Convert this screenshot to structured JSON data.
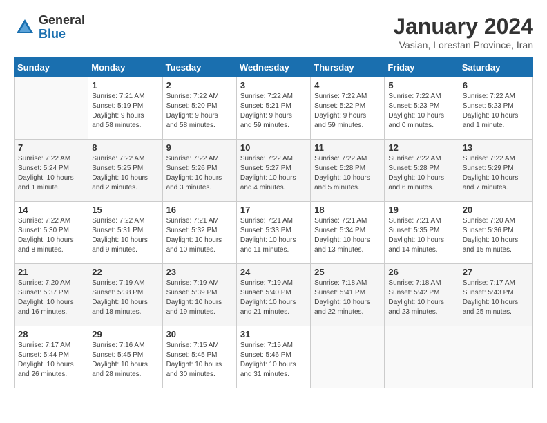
{
  "header": {
    "logo_general": "General",
    "logo_blue": "Blue",
    "title": "January 2024",
    "subtitle": "Vasian, Lorestan Province, Iran"
  },
  "weekdays": [
    "Sunday",
    "Monday",
    "Tuesday",
    "Wednesday",
    "Thursday",
    "Friday",
    "Saturday"
  ],
  "weeks": [
    [
      {
        "day": "",
        "info": ""
      },
      {
        "day": "1",
        "info": "Sunrise: 7:21 AM\nSunset: 5:19 PM\nDaylight: 9 hours\nand 58 minutes."
      },
      {
        "day": "2",
        "info": "Sunrise: 7:22 AM\nSunset: 5:20 PM\nDaylight: 9 hours\nand 58 minutes."
      },
      {
        "day": "3",
        "info": "Sunrise: 7:22 AM\nSunset: 5:21 PM\nDaylight: 9 hours\nand 59 minutes."
      },
      {
        "day": "4",
        "info": "Sunrise: 7:22 AM\nSunset: 5:22 PM\nDaylight: 9 hours\nand 59 minutes."
      },
      {
        "day": "5",
        "info": "Sunrise: 7:22 AM\nSunset: 5:23 PM\nDaylight: 10 hours\nand 0 minutes."
      },
      {
        "day": "6",
        "info": "Sunrise: 7:22 AM\nSunset: 5:23 PM\nDaylight: 10 hours\nand 1 minute."
      }
    ],
    [
      {
        "day": "7",
        "info": "Sunrise: 7:22 AM\nSunset: 5:24 PM\nDaylight: 10 hours\nand 1 minute."
      },
      {
        "day": "8",
        "info": "Sunrise: 7:22 AM\nSunset: 5:25 PM\nDaylight: 10 hours\nand 2 minutes."
      },
      {
        "day": "9",
        "info": "Sunrise: 7:22 AM\nSunset: 5:26 PM\nDaylight: 10 hours\nand 3 minutes."
      },
      {
        "day": "10",
        "info": "Sunrise: 7:22 AM\nSunset: 5:27 PM\nDaylight: 10 hours\nand 4 minutes."
      },
      {
        "day": "11",
        "info": "Sunrise: 7:22 AM\nSunset: 5:28 PM\nDaylight: 10 hours\nand 5 minutes."
      },
      {
        "day": "12",
        "info": "Sunrise: 7:22 AM\nSunset: 5:28 PM\nDaylight: 10 hours\nand 6 minutes."
      },
      {
        "day": "13",
        "info": "Sunrise: 7:22 AM\nSunset: 5:29 PM\nDaylight: 10 hours\nand 7 minutes."
      }
    ],
    [
      {
        "day": "14",
        "info": "Sunrise: 7:22 AM\nSunset: 5:30 PM\nDaylight: 10 hours\nand 8 minutes."
      },
      {
        "day": "15",
        "info": "Sunrise: 7:22 AM\nSunset: 5:31 PM\nDaylight: 10 hours\nand 9 minutes."
      },
      {
        "day": "16",
        "info": "Sunrise: 7:21 AM\nSunset: 5:32 PM\nDaylight: 10 hours\nand 10 minutes."
      },
      {
        "day": "17",
        "info": "Sunrise: 7:21 AM\nSunset: 5:33 PM\nDaylight: 10 hours\nand 11 minutes."
      },
      {
        "day": "18",
        "info": "Sunrise: 7:21 AM\nSunset: 5:34 PM\nDaylight: 10 hours\nand 13 minutes."
      },
      {
        "day": "19",
        "info": "Sunrise: 7:21 AM\nSunset: 5:35 PM\nDaylight: 10 hours\nand 14 minutes."
      },
      {
        "day": "20",
        "info": "Sunrise: 7:20 AM\nSunset: 5:36 PM\nDaylight: 10 hours\nand 15 minutes."
      }
    ],
    [
      {
        "day": "21",
        "info": "Sunrise: 7:20 AM\nSunset: 5:37 PM\nDaylight: 10 hours\nand 16 minutes."
      },
      {
        "day": "22",
        "info": "Sunrise: 7:19 AM\nSunset: 5:38 PM\nDaylight: 10 hours\nand 18 minutes."
      },
      {
        "day": "23",
        "info": "Sunrise: 7:19 AM\nSunset: 5:39 PM\nDaylight: 10 hours\nand 19 minutes."
      },
      {
        "day": "24",
        "info": "Sunrise: 7:19 AM\nSunset: 5:40 PM\nDaylight: 10 hours\nand 21 minutes."
      },
      {
        "day": "25",
        "info": "Sunrise: 7:18 AM\nSunset: 5:41 PM\nDaylight: 10 hours\nand 22 minutes."
      },
      {
        "day": "26",
        "info": "Sunrise: 7:18 AM\nSunset: 5:42 PM\nDaylight: 10 hours\nand 23 minutes."
      },
      {
        "day": "27",
        "info": "Sunrise: 7:17 AM\nSunset: 5:43 PM\nDaylight: 10 hours\nand 25 minutes."
      }
    ],
    [
      {
        "day": "28",
        "info": "Sunrise: 7:17 AM\nSunset: 5:44 PM\nDaylight: 10 hours\nand 26 minutes."
      },
      {
        "day": "29",
        "info": "Sunrise: 7:16 AM\nSunset: 5:45 PM\nDaylight: 10 hours\nand 28 minutes."
      },
      {
        "day": "30",
        "info": "Sunrise: 7:15 AM\nSunset: 5:45 PM\nDaylight: 10 hours\nand 30 minutes."
      },
      {
        "day": "31",
        "info": "Sunrise: 7:15 AM\nSunset: 5:46 PM\nDaylight: 10 hours\nand 31 minutes."
      },
      {
        "day": "",
        "info": ""
      },
      {
        "day": "",
        "info": ""
      },
      {
        "day": "",
        "info": ""
      }
    ]
  ]
}
